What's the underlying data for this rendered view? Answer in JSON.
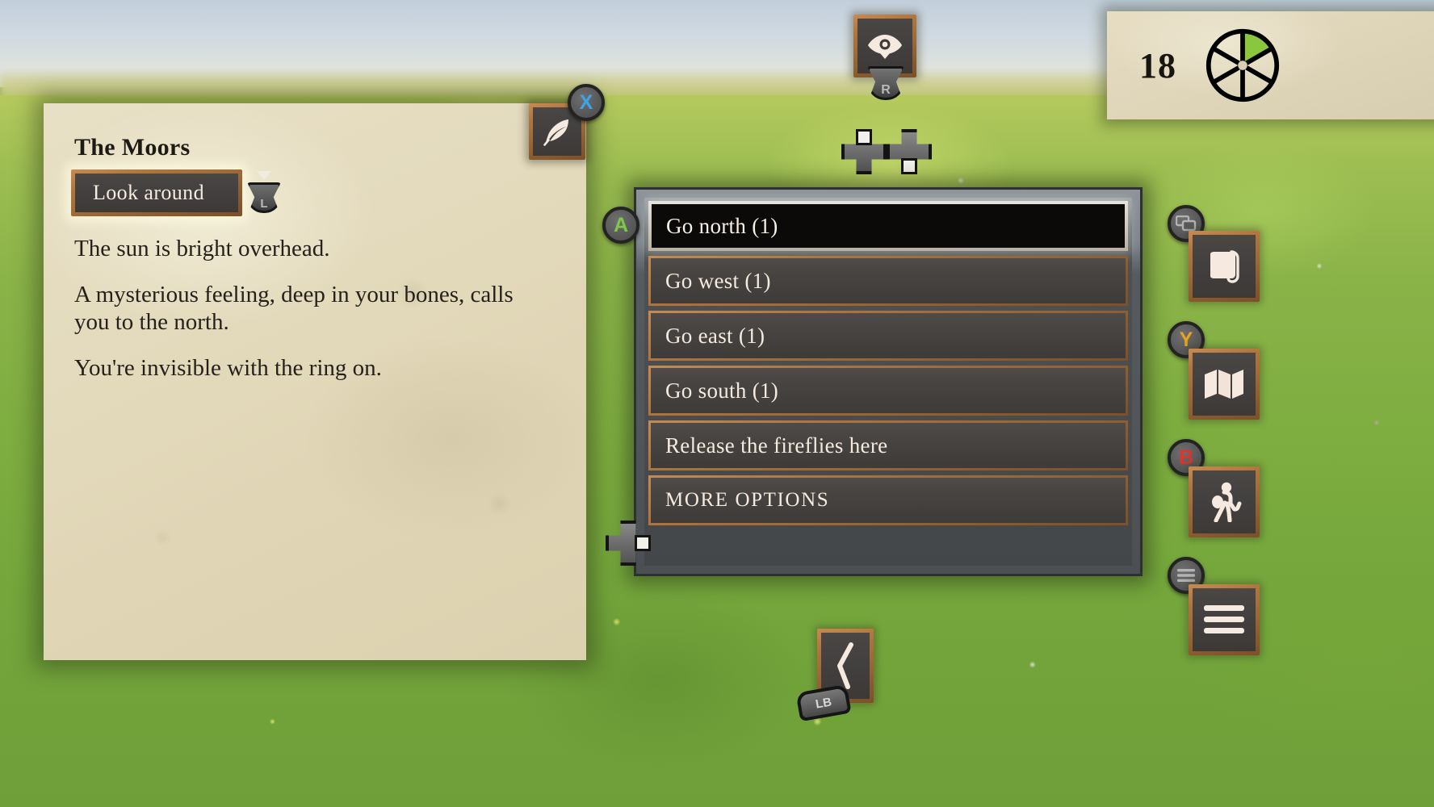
{
  "scene": {
    "location_name": "The Moors",
    "background": "sunny green meadow with wildflowers under a pale blue sky"
  },
  "story_panel": {
    "title": "The Moors",
    "action_chip": {
      "label": "Look around",
      "stick_hint": "L"
    },
    "paragraphs": [
      "The sun is bright overhead.",
      "A mysterious feeling, deep in your bones, calls you to the north.",
      "You're invisible with the ring on."
    ],
    "quill_button": {
      "icon": "quill-icon",
      "pad_button": "X",
      "pad_color": "#3fa3e8"
    }
  },
  "look_control": {
    "icon": "eye-icon",
    "stick_hint": "R",
    "dpad_up_label": "",
    "dpad_down_label": ""
  },
  "choice_menu": {
    "pad_button": "A",
    "pad_color": "#7ec845",
    "more_pad_hint": "dpad-right",
    "items": [
      {
        "label": "Go north (1)",
        "selected": true,
        "caps": false
      },
      {
        "label": "Go west (1)",
        "selected": false,
        "caps": false
      },
      {
        "label": "Go east (1)",
        "selected": false,
        "caps": false
      },
      {
        "label": "Go south (1)",
        "selected": false,
        "caps": false
      },
      {
        "label": "Release the fireflies here",
        "selected": false,
        "caps": false
      },
      {
        "label": "MORE OPTIONS",
        "selected": false,
        "caps": true
      }
    ]
  },
  "score_widget": {
    "value": "18",
    "wheel": {
      "segments": 6,
      "filled_segments": 1,
      "filled_color": "#8bc63f",
      "empty_color": "#ffffff",
      "stroke_color": "#000000"
    }
  },
  "sidebar": {
    "select_badge_icon": "windows-select-icon",
    "items": [
      {
        "name": "journal",
        "icon": "journal-icon",
        "pad_button": "",
        "pad_color": ""
      },
      {
        "name": "map",
        "icon": "map-icon",
        "pad_button": "Y",
        "pad_color": "#e4a51d"
      },
      {
        "name": "travel",
        "icon": "traveler-icon",
        "pad_button": "B",
        "pad_color": "#e0342a"
      },
      {
        "name": "menu",
        "icon": "hamburger-icon",
        "pad_button": "",
        "pad_color": ""
      }
    ]
  },
  "back_control": {
    "icon": "chevron-left-icon",
    "shoulder_label": "LB"
  }
}
